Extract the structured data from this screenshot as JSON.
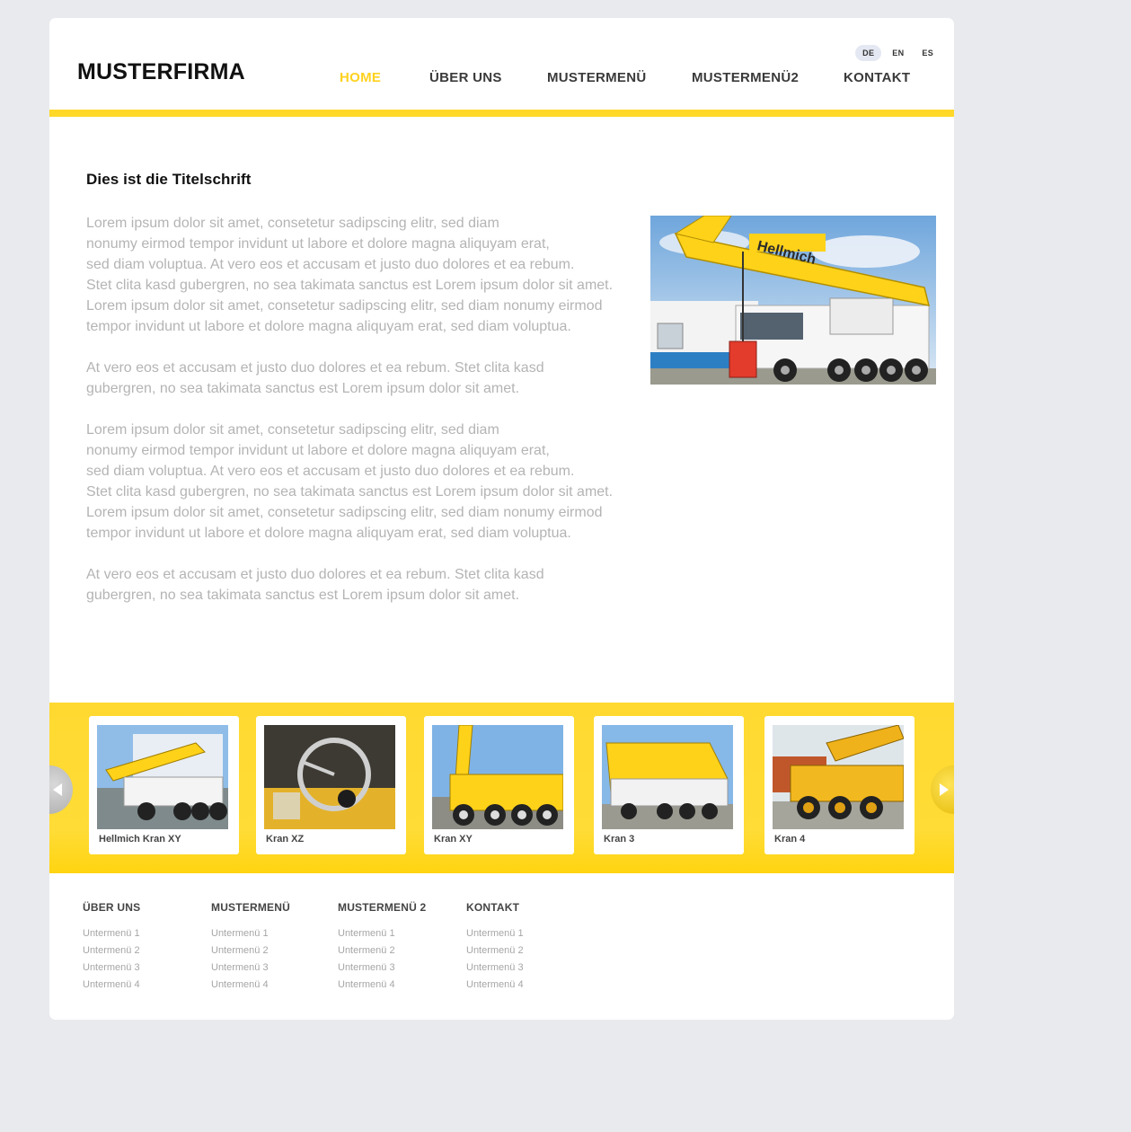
{
  "header": {
    "logo": "MUSTERFIRMA",
    "languages": [
      "DE",
      "EN",
      "ES"
    ],
    "active_language": "DE",
    "nav": [
      "HOME",
      "ÜBER UNS",
      "MUSTERMENÜ",
      "MUSTERMENÜ2",
      "KONTAKT"
    ],
    "active_nav": "HOME"
  },
  "content": {
    "title": "Dies ist die Titelschrift",
    "paragraphs": [
      "Lorem ipsum dolor sit amet, consetetur sadipscing elitr, sed diam\nnonumy eirmod tempor invidunt ut labore et dolore magna aliquyam erat,\nsed diam voluptua. At vero eos et accusam et justo duo dolores et ea rebum.\nStet clita kasd gubergren, no sea takimata sanctus est Lorem ipsum dolor sit amet.\nLorem ipsum dolor sit amet, consetetur sadipscing elitr, sed diam nonumy eirmod\ntempor invidunt ut labore et dolore magna aliquyam erat, sed diam voluptua.",
      "At vero eos et accusam et justo duo dolores et ea rebum. Stet clita kasd\ngubergren, no sea takimata sanctus est Lorem ipsum dolor sit amet.",
      "Lorem ipsum dolor sit amet, consetetur sadipscing elitr, sed diam\nnonumy eirmod tempor invidunt ut labore et dolore magna aliquyam erat,\nsed diam voluptua. At vero eos et accusam et justo duo dolores et ea rebum.\nStet clita kasd gubergren, no sea takimata sanctus est Lorem ipsum dolor sit amet.\nLorem ipsum dolor sit amet, consetetur sadipscing elitr, sed diam nonumy eirmod\ntempor invidunt ut labore et dolore magna aliquyam erat, sed diam voluptua.",
      "At vero eos et accusam et justo duo dolores et ea rebum. Stet clita kasd\ngubergren, no sea takimata sanctus est Lorem ipsum dolor sit amet."
    ],
    "hero_logo_text": "Hellmich"
  },
  "gallery": {
    "items": [
      {
        "caption": "Hellmich Kran XY"
      },
      {
        "caption": "Kran XZ"
      },
      {
        "caption": "Kran XY"
      },
      {
        "caption": "Kran 3"
      },
      {
        "caption": "Kran 4"
      }
    ]
  },
  "footer": {
    "columns": [
      {
        "heading": "ÜBER UNS",
        "links": [
          "Untermenü 1",
          "Untermenü 2",
          "Untermenü 3",
          "Untermenü 4"
        ]
      },
      {
        "heading": "MUSTERMENÜ",
        "links": [
          "Untermenü 1",
          "Untermenü 2",
          "Untermenü 3",
          "Untermenü 4"
        ]
      },
      {
        "heading": "MUSTERMENÜ 2",
        "links": [
          "Untermenü 1",
          "Untermenü 2",
          "Untermenü 3",
          "Untermenü 4"
        ]
      },
      {
        "heading": "KONTAKT",
        "links": [
          "Untermenü 1",
          "Untermenü 2",
          "Untermenü 3",
          "Untermenü 4"
        ]
      }
    ]
  },
  "colors": {
    "accent": "#ffd82a",
    "active_nav": "#ffd21f",
    "page_background": "#e9eaee"
  },
  "icons": [
    "chevron-left-icon",
    "chevron-right-icon"
  ]
}
